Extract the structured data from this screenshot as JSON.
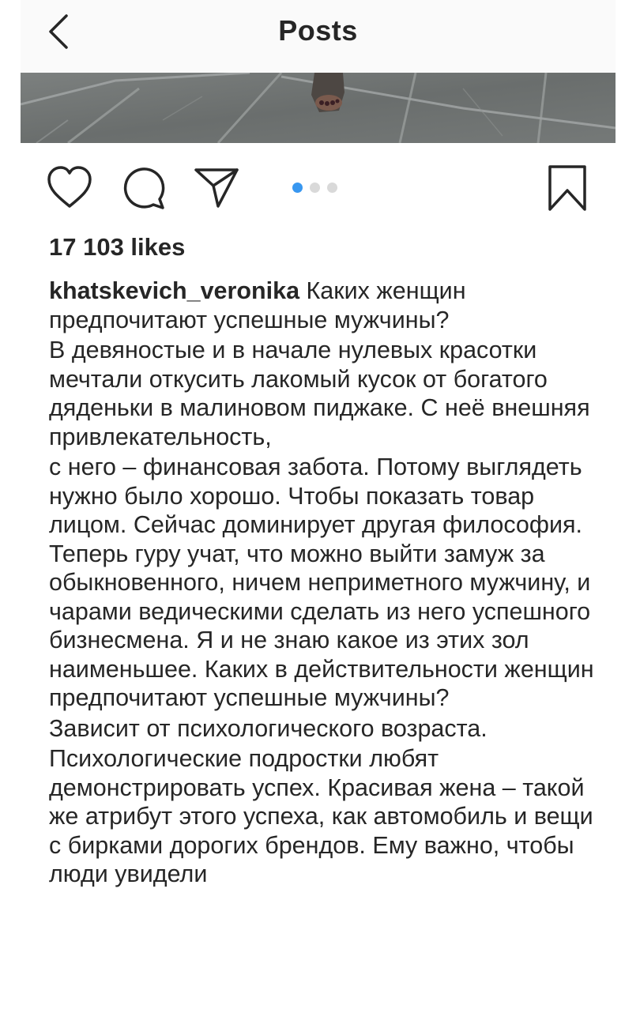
{
  "header": {
    "title": "Posts"
  },
  "post": {
    "likes": "17 103 likes",
    "carousel": {
      "total": 3,
      "active_index": 0,
      "active_color": "#3897f0"
    },
    "username": "khatskevich_veronika",
    "caption_first": " Каких женщин предпочитают успешные мужчины?",
    "paragraphs": [
      "В девяностые и в начале нулевых красотки мечтали откусить лакомый кусок от богатого дяденьки в малиновом пиджаке. С неё внешняя привлекательность,",
      "с него – финансовая забота. Потому выглядеть нужно было хорошо. Чтобы показать товар лицом. Сейчас доминирует другая философия. Теперь гуру учат, что можно выйти замуж за обыкновенного, ничем неприметного мужчину, и чарами ведическими сделать из него успешного бизнесмена. Я и не знаю какое из этих зол наименьшее. Каких в действительности женщин предпочитают успешные мужчины?",
      "Зависит от психологического возраста.",
      "Психологические подростки любят демонстрировать успех. Красивая жена – такой же атрибут этого успеха, как автомобиль и вещи с бирками дорогих брендов. Ему важно, чтобы люди увидели"
    ]
  },
  "icons": {
    "back": "chevron-left-icon",
    "like": "heart-icon",
    "comment": "comment-bubble-icon",
    "share": "paper-plane-icon",
    "save": "bookmark-icon"
  }
}
